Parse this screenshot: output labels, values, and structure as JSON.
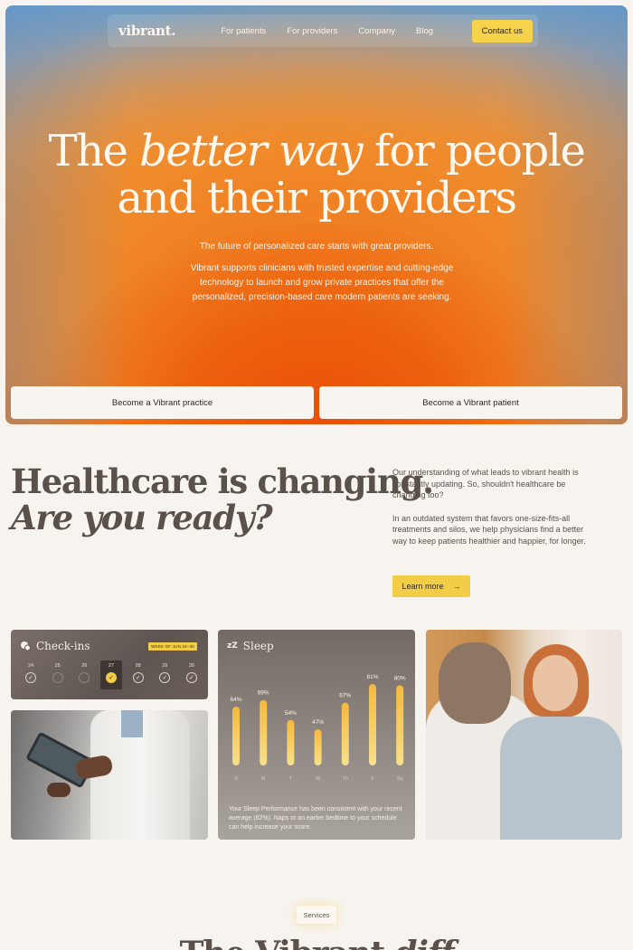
{
  "nav": {
    "logo": "vibrant.",
    "links": [
      "For patients",
      "For providers",
      "Company",
      "Blog"
    ],
    "contact": "Contact us"
  },
  "hero": {
    "title_pre": "The ",
    "title_em": "better way",
    "title_post": " for people",
    "title_line2": "and their providers",
    "subtitle": "The future of personalized care starts with great providers.",
    "body": "Vibrant supports clinicians with trusted expertise and cutting-edge technology to launch and grow private practices that offer the personalized, precision-based care modern patients are seeking.",
    "cta_practice": "Become a Vibrant practice",
    "cta_patient": "Become a Vibrant patient"
  },
  "changing": {
    "line1": "Healthcare is changing.",
    "line2": "Are you ready?",
    "para1": "Our understanding of what leads to vibrant health is constantly updating. So, shouldn't healthcare be changing too?",
    "para2": "In an outdated system that favors one-size-fits-all treatments and silos, we help physicians find a better way to keep patients healthier and happier, for longer.",
    "learn_more": "Learn more"
  },
  "checkins": {
    "title": "Check-ins",
    "badge": "WEEK OF JUN 24–30",
    "days": [
      {
        "num": "24",
        "state": "done"
      },
      {
        "num": "25",
        "state": "empty"
      },
      {
        "num": "26",
        "state": "empty"
      },
      {
        "num": "27",
        "state": "today"
      },
      {
        "num": "28",
        "state": "done"
      },
      {
        "num": "29",
        "state": "done"
      },
      {
        "num": "30",
        "state": "done"
      }
    ]
  },
  "sleep": {
    "title": "Sleep",
    "note": "Your Sleep Performance has been consistent with your recent average (62%). Naps or an earlier bedtime to your schedule can help increase your score."
  },
  "chart_data": {
    "type": "bar",
    "categories": [
      "S",
      "M",
      "T",
      "W",
      "Th",
      "F",
      "Sa"
    ],
    "values": [
      64,
      69,
      54,
      47,
      67,
      81,
      80
    ],
    "value_labels": [
      "64%",
      "69%",
      "54%",
      "47%",
      "67%",
      "81%",
      "80%"
    ],
    "title": "Sleep",
    "ylim": [
      0,
      100
    ],
    "colors": {
      "top": "#f6b93b",
      "bottom": "#f8e08a"
    }
  },
  "services": {
    "badge": "Services",
    "title_pre": "The Vibrant ",
    "title_em": "diff"
  }
}
